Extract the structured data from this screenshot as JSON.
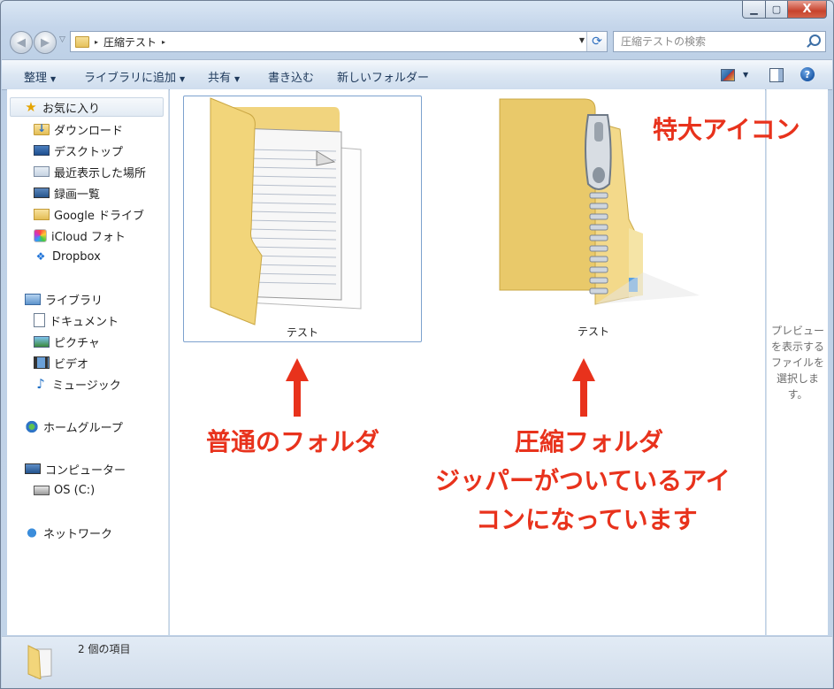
{
  "window": {
    "controls": {
      "minimize": "▁",
      "maximize": "▢",
      "close": "X"
    }
  },
  "address": {
    "nav_back": "◀",
    "nav_forward": "▶",
    "recent": "▽",
    "crumbs": [
      "圧縮テスト"
    ],
    "separator": "▸",
    "dropdown": "▼",
    "refresh": "⟳",
    "search_placeholder": "圧縮テストの検索"
  },
  "toolbar": {
    "organize": "整理",
    "add_to_library": "ライブラリに追加",
    "share": "共有",
    "burn": "書き込む",
    "new_folder": "新しいフォルダー",
    "dropdown_glyph": "▼",
    "help": "?"
  },
  "sidebar": {
    "favorites": {
      "label": "お気に入り",
      "items": [
        "ダウンロード",
        "デスクトップ",
        "最近表示した場所",
        "録画一覧",
        "Google ドライブ",
        "iCloud フォト",
        "Dropbox"
      ]
    },
    "libraries": {
      "label": "ライブラリ",
      "items": [
        "ドキュメント",
        "ピクチャ",
        "ビデオ",
        "ミュージック"
      ]
    },
    "homegroup": "ホームグループ",
    "computer": {
      "label": "コンピューター",
      "items": [
        "OS (C:)"
      ]
    },
    "network": "ネットワーク"
  },
  "files": [
    {
      "name": "テスト",
      "type": "folder",
      "selected": true
    },
    {
      "name": "テスト",
      "type": "compressed-folder",
      "selected": false
    }
  ],
  "preview": {
    "message_lines": [
      "プレビュー",
      "を表示する",
      "ファイルを",
      "選択しま",
      "す。"
    ]
  },
  "annotations": {
    "top_right": "特大アイコン",
    "left": "普通のフォルダ",
    "right_line1": "圧縮フォルダ",
    "right_line2": "ジッパーがついているアイ",
    "right_line3": "コンになっています"
  },
  "status": {
    "count_text": "2 個の項目"
  },
  "colors": {
    "annotation_red": "#e8321c",
    "selection_border": "#7da2ce",
    "folder_yellow": "#f2d57a"
  }
}
